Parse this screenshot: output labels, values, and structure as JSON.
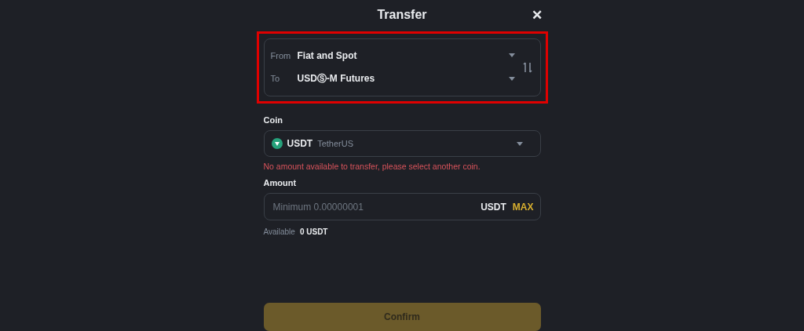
{
  "dialog": {
    "title": "Transfer",
    "close": "✕"
  },
  "accounts": {
    "highlighted": true,
    "from": {
      "label": "From",
      "value": "Fiat and Spot"
    },
    "to": {
      "label": "To",
      "value": "USDⓈ-M Futures"
    }
  },
  "coin": {
    "label": "Coin",
    "symbol": "USDT",
    "name": "TetherUS",
    "error": "No amount available to transfer, please select another coin."
  },
  "amount": {
    "label": "Amount",
    "placeholder": "Minimum 0.00000001",
    "unit": "USDT",
    "max": "MAX",
    "available_label": "Available",
    "available_value": "0 USDT"
  },
  "confirm": {
    "label": "Confirm",
    "disabled": true
  }
}
